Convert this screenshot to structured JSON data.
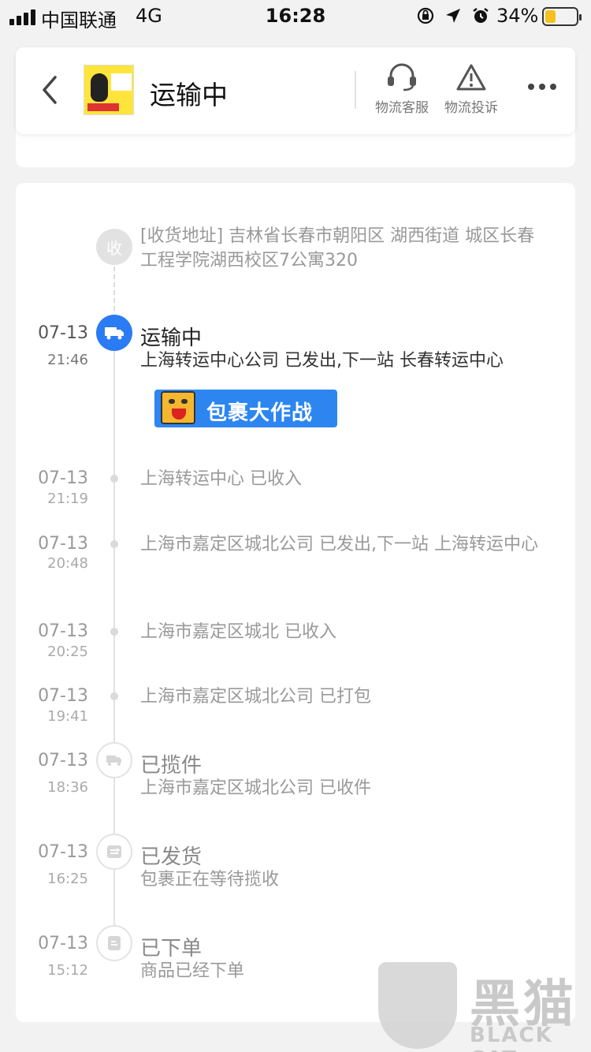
{
  "status_bar": {
    "carrier": "中国联通",
    "network": "4G",
    "time": "16:28",
    "battery_percent": "34%",
    "battery_level": 0.34
  },
  "header": {
    "title": "运输中",
    "customer_service_label": "物流客服",
    "complaint_label": "物流投诉"
  },
  "address": {
    "label": "[收货地址] 吉林省长春市朝阳区  湖西街道   城区长春工程学院湖西校区7公寓320",
    "node_char": "收"
  },
  "promo": {
    "label": "包裹大作战"
  },
  "events": [
    {
      "date": "07-13",
      "time": "21:46",
      "title": "运输中",
      "desc": "上海转运中心公司 已发出,下一站 长春转运中心"
    },
    {
      "date": "07-13",
      "time": "21:19",
      "title": "",
      "desc": "上海转运中心 已收入"
    },
    {
      "date": "07-13",
      "time": "20:48",
      "title": "",
      "desc": "上海市嘉定区城北公司 已发出,下一站 上海转运中心"
    },
    {
      "date": "07-13",
      "time": "20:25",
      "title": "",
      "desc": "上海市嘉定区城北 已收入"
    },
    {
      "date": "07-13",
      "time": "19:41",
      "title": "",
      "desc": "上海市嘉定区城北公司 已打包"
    },
    {
      "date": "07-13",
      "time": "18:36",
      "title": "已揽件",
      "desc": "上海市嘉定区城北公司 已收件"
    },
    {
      "date": "07-13",
      "time": "16:25",
      "title": "已发货",
      "desc": "包裹正在等待揽收"
    },
    {
      "date": "07-13",
      "time": "15:12",
      "title": "已下单",
      "desc": "商品已经下单"
    }
  ],
  "watermark": {
    "cn": "黑猫",
    "en": "BLACK CAT"
  }
}
